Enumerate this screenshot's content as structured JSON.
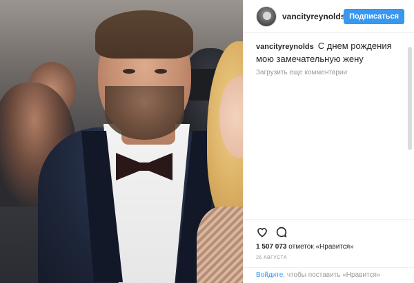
{
  "post": {
    "author": {
      "username": "vancityreynolds",
      "verified": true,
      "avatar_icon": "user-avatar-icon"
    },
    "follow_label": "Подписаться",
    "caption": {
      "username": "vancityreynolds",
      "text": "С днем рождения мою замечательную жену"
    },
    "load_more_comments": "Загрузить еще комментарии",
    "icons": {
      "like": "heart-icon",
      "comment": "comment-bubble-icon",
      "verified": "verified-check-icon"
    },
    "likes_count": "1 507 073",
    "likes_suffix": "отметок «Нравится»",
    "date": "26 августа",
    "login": {
      "link": "Войдите",
      "rest": ", чтобы поставить «Нравится»"
    }
  },
  "colors": {
    "accent": "#3897f0",
    "text": "#262626",
    "muted": "#999999",
    "border": "#efefef"
  }
}
